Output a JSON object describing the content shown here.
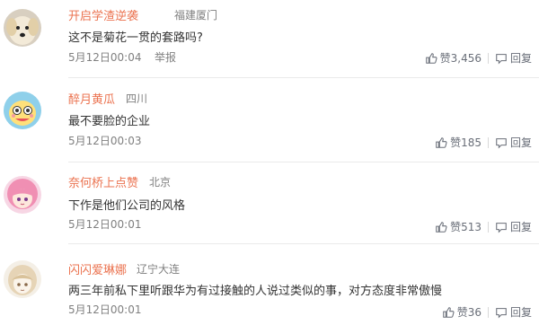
{
  "report_label": "举报",
  "reply_label": "回复",
  "like_prefix": "赞",
  "comments": [
    {
      "username": "开启学渣逆袭",
      "location": "福建厦门",
      "text": "这不是菊花一贯的套路吗?",
      "time": "5月12日00:04",
      "likes": "3,456",
      "show_report": true,
      "avatar": "dog-avatar"
    },
    {
      "username": "醉月黄瓜",
      "location": "四川",
      "text": "最不要脸的企业",
      "time": "5月12日00:03",
      "likes": "185",
      "show_report": false,
      "avatar": "cartoon-face-avatar"
    },
    {
      "username": "奈何桥上点赞",
      "location": "北京",
      "text": "下作是他们公司的风格",
      "time": "5月12日00:01",
      "likes": "513",
      "show_report": false,
      "avatar": "anime-girl-pink-avatar"
    },
    {
      "username": "闪闪爱琳娜",
      "location": "辽宁大连",
      "text": "两三年前私下里听跟华为有过接触的人说过类似的事，对方态度非常傲慢",
      "time": "5月12日00:01",
      "likes": "36",
      "show_report": false,
      "avatar": "anime-girl-sketch-avatar"
    }
  ],
  "colors": {
    "username": "#eb7350",
    "meta": "#808080",
    "text": "#333333"
  }
}
